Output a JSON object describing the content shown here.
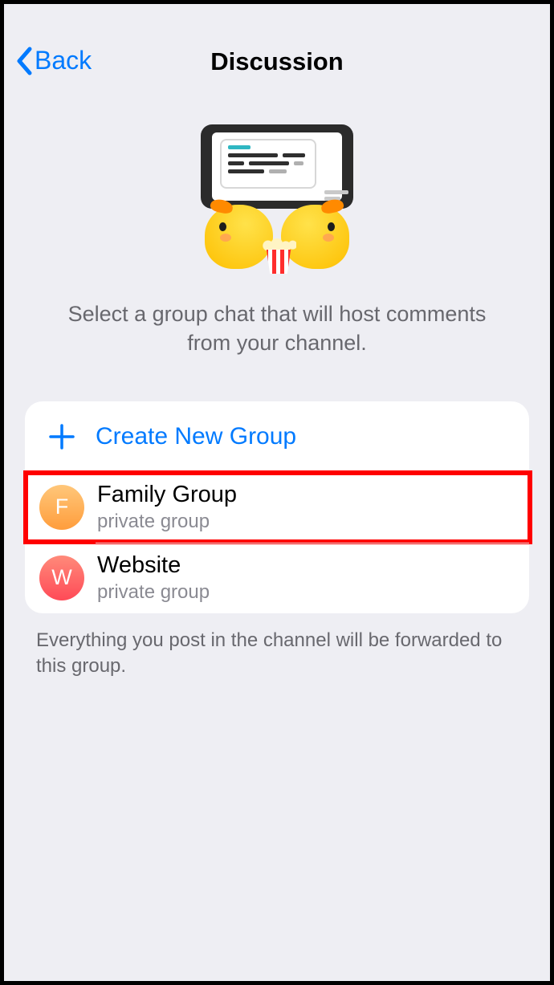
{
  "header": {
    "back_label": "Back",
    "title": "Discussion"
  },
  "subtitle": "Select a group chat that will host comments from your channel.",
  "list": {
    "create_label": "Create New Group",
    "groups": [
      {
        "initial": "F",
        "name": "Family Group",
        "subtitle": "private group",
        "avatar_class": "av-orange",
        "highlighted": true
      },
      {
        "initial": "W",
        "name": "Website",
        "subtitle": "private group",
        "avatar_class": "av-red",
        "highlighted": false
      }
    ]
  },
  "footer": "Everything you post in the channel will be forwarded to this group."
}
